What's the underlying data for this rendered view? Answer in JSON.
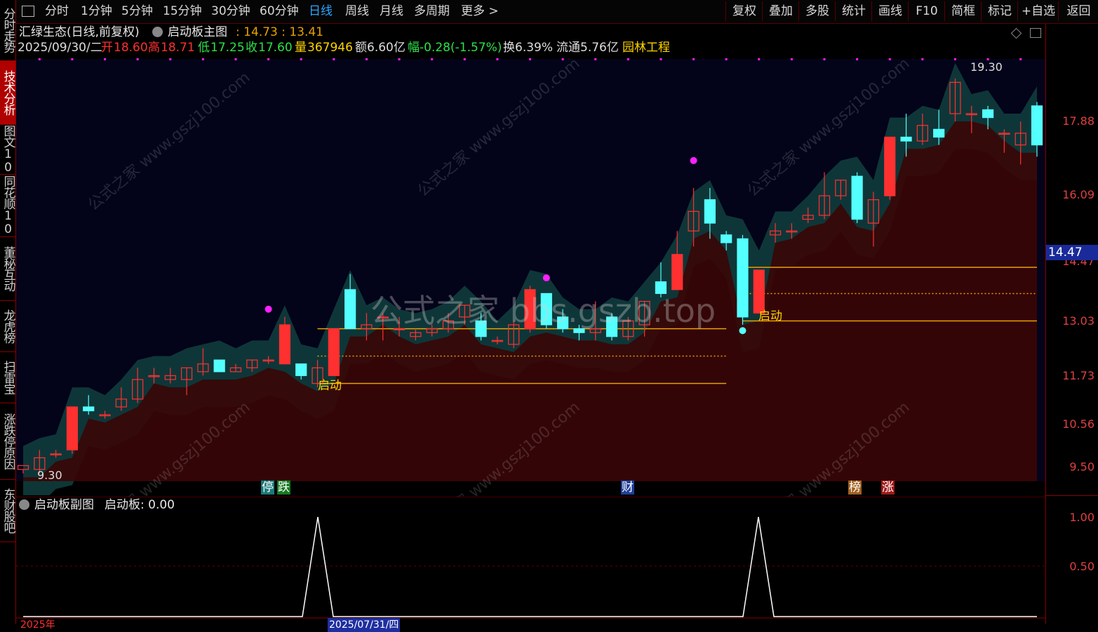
{
  "topbar": {
    "left_items": [
      "分时",
      "1分钟",
      "5分钟",
      "15分钟",
      "30分钟",
      "60分钟",
      "日线",
      "周线",
      "月线",
      "多周期",
      "更多 >"
    ],
    "active_item": "日线",
    "right_items": [
      "复权",
      "叠加",
      "多股",
      "统计",
      "画线",
      "F10",
      "简框",
      "标记",
      "+自选",
      "返回"
    ]
  },
  "sidebar": {
    "items": [
      "分时走势",
      "技术分析",
      "图文10",
      "同花顺10",
      "董秘互动",
      "龙虎榜",
      "扫雷宝",
      "涨跌停原因",
      "东财股吧"
    ],
    "active": "技术分析"
  },
  "chart_header": {
    "title": "汇绿生态(日线,前复权)",
    "indicator_name": "启动板主图",
    "indicator_values": ": 14.73 : 13.41",
    "date": "2025/09/30/二",
    "open_label": "开",
    "open": "18.60",
    "high_label": "高",
    "high": "18.71",
    "low_label": "低",
    "low": "17.25",
    "close_label": "收",
    "close": "17.60",
    "vol_label": "量",
    "vol": "367946",
    "amount": "额6.60亿",
    "change": "幅-0.28(-1.57%)",
    "turnover": "换6.39%",
    "float_cap": "流通5.76亿",
    "sector": "园林工程"
  },
  "price_axis": {
    "labels": [
      "17.88",
      "16.09",
      "14.47",
      "13.03",
      "11.73",
      "10.56",
      "9.50"
    ],
    "current_price": "14.47"
  },
  "sub_axis": {
    "labels": [
      "1.00",
      "0.50"
    ]
  },
  "annotations": {
    "high_label": "19.30",
    "low_label": "9.30",
    "start_label": "启动",
    "event_tags": [
      "停",
      "跌",
      "财",
      "榜",
      "涨"
    ],
    "center_watermark": "公式之家 bbs.gszb.top",
    "watermark": "公式之家 www.gszj100.com"
  },
  "sub_header": {
    "indicator": "启动板副图",
    "value_label": "启动板: 0.00"
  },
  "bottom": {
    "date_label": "2025/07/31/四",
    "year_label": "2025年"
  },
  "chart_data": {
    "type": "candlestick",
    "ylim": [
      9.0,
      19.8
    ],
    "candles": [
      [
        9.3,
        9.4,
        9.2,
        9.3
      ],
      [
        9.3,
        9.6,
        9.2,
        9.8
      ],
      [
        9.7,
        9.7,
        9.6,
        9.8
      ],
      [
        9.8,
        10.9,
        9.7,
        10.9
      ],
      [
        10.9,
        10.8,
        10.7,
        11.2
      ],
      [
        10.7,
        10.7,
        10.6,
        10.8
      ],
      [
        10.9,
        11.1,
        10.8,
        11.4
      ],
      [
        11.1,
        11.6,
        11.0,
        11.9
      ],
      [
        11.7,
        11.7,
        11.5,
        11.9
      ],
      [
        11.6,
        11.7,
        11.5,
        11.9
      ],
      [
        11.6,
        11.9,
        11.2,
        11.9
      ],
      [
        11.8,
        12.0,
        11.7,
        12.4
      ],
      [
        12.1,
        11.8,
        11.8,
        12.1
      ],
      [
        11.8,
        11.9,
        11.8,
        12.0
      ],
      [
        11.9,
        12.1,
        11.8,
        12.1
      ],
      [
        12.1,
        12.1,
        12.0,
        12.2
      ],
      [
        12.0,
        13.0,
        12.0,
        13.2
      ],
      [
        12.0,
        11.7,
        11.6,
        12.0
      ],
      [
        11.5,
        11.9,
        11.4,
        12.1
      ],
      [
        11.7,
        12.9,
        11.7,
        12.9
      ],
      [
        13.9,
        12.9,
        12.9,
        14.3
      ],
      [
        12.9,
        13.0,
        12.6,
        13.3
      ],
      [
        13.2,
        13.2,
        12.6,
        13.3
      ],
      [
        12.9,
        12.9,
        12.7,
        13.2
      ],
      [
        12.7,
        12.8,
        12.6,
        12.9
      ],
      [
        12.8,
        12.9,
        12.7,
        13.0
      ],
      [
        12.9,
        13.1,
        12.8,
        13.3
      ],
      [
        13.2,
        13.5,
        13.0,
        13.5
      ],
      [
        13.1,
        12.7,
        12.6,
        13.3
      ],
      [
        12.6,
        12.6,
        12.5,
        12.7
      ],
      [
        12.5,
        13.0,
        12.4,
        13.1
      ],
      [
        12.9,
        13.9,
        12.8,
        14.0
      ],
      [
        13.8,
        13.0,
        12.9,
        13.8
      ],
      [
        13.2,
        12.9,
        12.8,
        13.4
      ],
      [
        12.9,
        12.8,
        12.6,
        13.0
      ],
      [
        12.8,
        12.9,
        12.6,
        13.6
      ],
      [
        13.2,
        12.7,
        12.6,
        13.3
      ],
      [
        12.7,
        13.1,
        12.6,
        13.2
      ],
      [
        13.0,
        13.6,
        12.7,
        13.6
      ],
      [
        14.1,
        13.8,
        13.7,
        14.6
      ],
      [
        13.9,
        14.8,
        13.9,
        15.4
      ],
      [
        15.4,
        15.9,
        15.0,
        16.5
      ],
      [
        16.2,
        15.6,
        15.2,
        16.5
      ],
      [
        15.3,
        15.1,
        14.9,
        15.4
      ],
      [
        15.2,
        13.2,
        13.0,
        15.3
      ],
      [
        13.3,
        14.4,
        13.3,
        14.4
      ],
      [
        15.3,
        15.4,
        15.1,
        15.6
      ],
      [
        15.4,
        15.4,
        15.2,
        15.6
      ],
      [
        15.7,
        15.8,
        15.6,
        16.0
      ],
      [
        15.8,
        16.3,
        15.7,
        16.9
      ],
      [
        16.3,
        16.7,
        16.2,
        16.7
      ],
      [
        16.8,
        15.7,
        15.6,
        16.9
      ],
      [
        15.6,
        16.2,
        15.0,
        16.4
      ],
      [
        16.3,
        17.8,
        16.2,
        17.8
      ],
      [
        17.8,
        17.7,
        17.3,
        18.4
      ],
      [
        17.7,
        18.1,
        17.6,
        18.4
      ],
      [
        18.0,
        17.8,
        17.6,
        18.5
      ],
      [
        18.4,
        19.2,
        18.2,
        19.3
      ],
      [
        18.4,
        18.4,
        17.9,
        18.6
      ],
      [
        18.5,
        18.3,
        18.0,
        18.6
      ],
      [
        17.9,
        17.9,
        17.4,
        18.0
      ],
      [
        17.6,
        17.9,
        17.1,
        18.2
      ],
      [
        18.6,
        17.6,
        17.3,
        18.7
      ]
    ]
  }
}
